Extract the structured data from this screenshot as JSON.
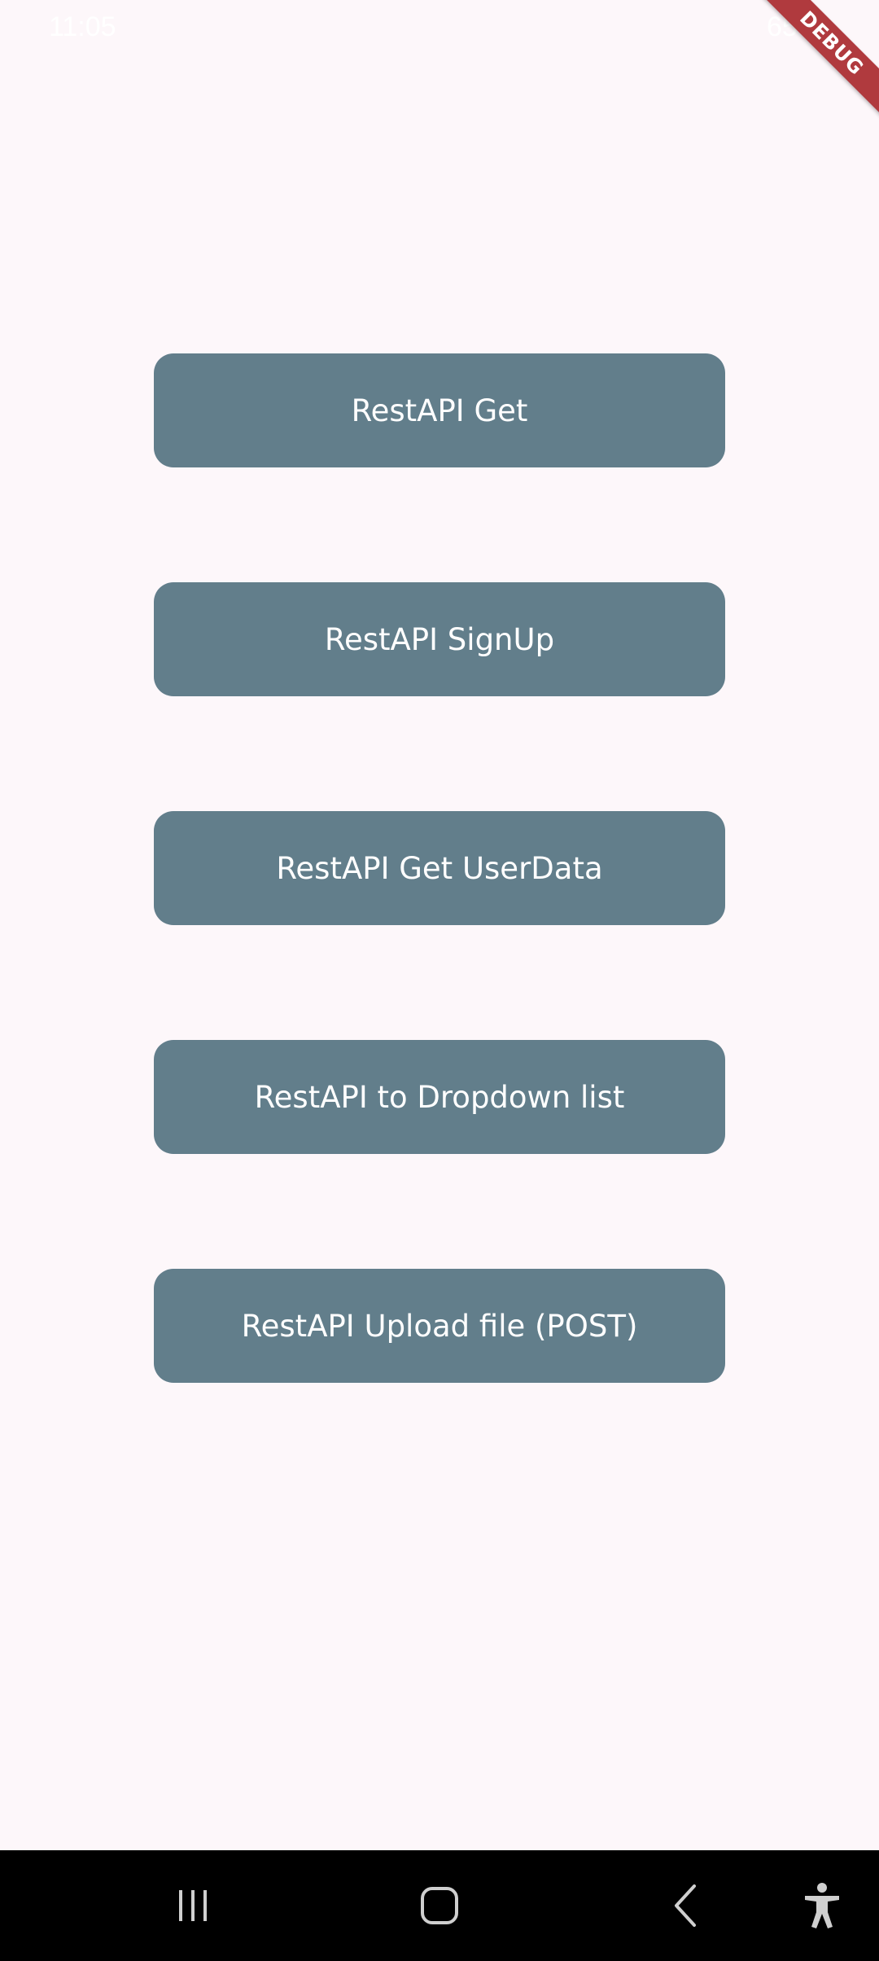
{
  "status_bar": {
    "time": "11:05",
    "battery": "65%"
  },
  "debug_banner": {
    "label": "DEBUG",
    "color": "#b03a3e"
  },
  "buttons": [
    {
      "label": "RestAPI Get"
    },
    {
      "label": "RestAPI SignUp"
    },
    {
      "label": "RestAPI Get UserData"
    },
    {
      "label": "RestAPI to Dropdown list"
    },
    {
      "label": "RestAPI Upload file (POST)"
    }
  ],
  "colors": {
    "background": "#fdf7fa",
    "button": "#627e8b",
    "button_text": "#ffffff",
    "nav_bar": "#000000"
  },
  "nav_bar": {
    "icons": [
      "recent-apps-icon",
      "home-icon",
      "back-icon",
      "accessibility-icon"
    ]
  }
}
